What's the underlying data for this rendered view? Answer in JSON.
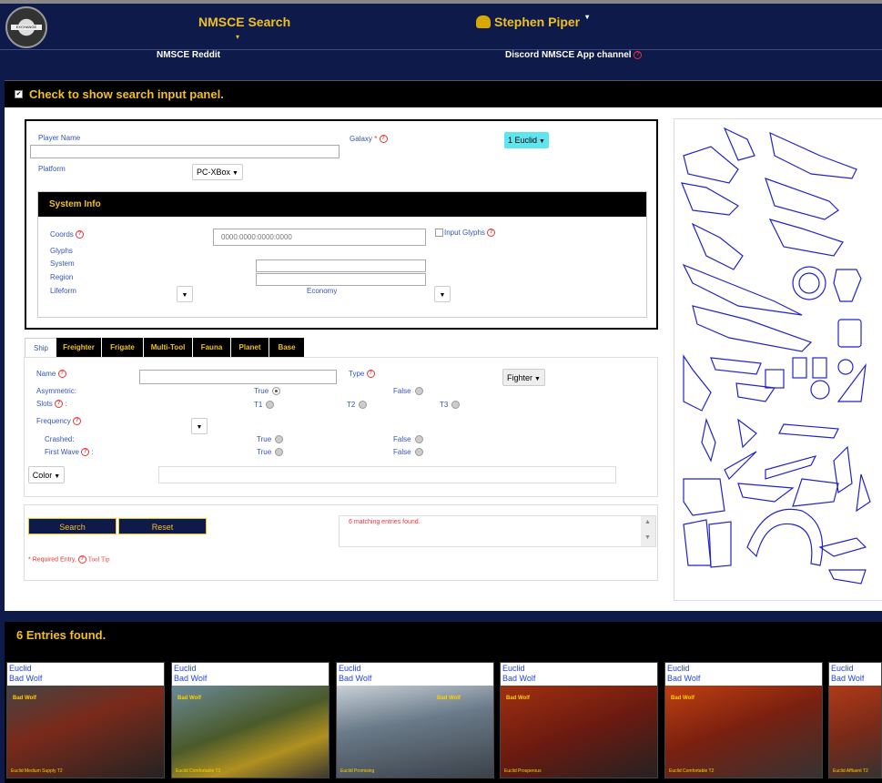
{
  "navbar": {
    "logo_text": "EXCHANGE",
    "search_label": "NMSCE Search",
    "search_caret": "▾",
    "user_label": "Stephen Piper",
    "user_caret": "▾"
  },
  "sublinks": {
    "reddit": "NMSCE Reddit",
    "discord": "Discord NMSCE App channel"
  },
  "panel_toggle": {
    "checkbox": "✔",
    "label": "Check to show search input panel."
  },
  "player": {
    "player_name_label": "Player Name",
    "galaxy_label": "Galaxy",
    "galaxy_required": "*",
    "galaxy_value": "1 Euclid",
    "platform_label": "Platform",
    "platform_value": "PC-XBox"
  },
  "system_info": {
    "title": "System Info",
    "coords_label": "Coords",
    "coords_placeholder": "0000:0000:0000:0000",
    "input_glyphs_label": "Input Glyphs",
    "glyphs_label": "Glyphs",
    "system_label": "System",
    "region_label": "Region",
    "lifeform_label": "Lifeform",
    "economy_label": "Economy"
  },
  "tabs": [
    "Ship",
    "Freighter",
    "Frigate",
    "Multi-Tool",
    "Fauna",
    "Planet",
    "Base"
  ],
  "ship": {
    "name_label": "Name",
    "type_label": "Type",
    "type_value": "Fighter",
    "asymmetric_label": "Asymmetric:",
    "true_label": "True",
    "false_label": "False",
    "slots_label": "Slots",
    "slots_colon": ":",
    "t1": "T1",
    "t2": "T2",
    "t3": "T3",
    "frequency_label": "Frequency",
    "crashed_label": "Crashed:",
    "first_wave_label": "First Wave",
    "first_wave_colon": ":",
    "color_label": "Color"
  },
  "actions": {
    "search": "Search",
    "reset": "Reset",
    "required_entry": "* Required Entry,",
    "tool_tip": "Tool Tip",
    "message": "6 matching entries found."
  },
  "entries": {
    "heading": "6 Entries found.",
    "cards": [
      {
        "galaxy": "Euclid",
        "player": "Bad Wolf",
        "ship_name": "Bad Wolf",
        "caption": "Euclid Medium Supply T2",
        "bg": "#7a2a1a"
      },
      {
        "galaxy": "Euclid",
        "player": "Bad Wolf",
        "ship_name": "Bad Wolf",
        "caption": "Euclid  Comfortable  T2",
        "bg": "#4a5a2a"
      },
      {
        "galaxy": "Euclid",
        "player": "Bad Wolf",
        "ship_name": "Bad Wolf",
        "caption": "Euclid  Promising",
        "bg": "#6a7a88"
      },
      {
        "galaxy": "Euclid",
        "player": "Bad Wolf",
        "ship_name": "Bad Wolf",
        "caption": "Euclid  Prosperous",
        "bg": "#6a1a10"
      },
      {
        "galaxy": "Euclid",
        "player": "Bad Wolf",
        "ship_name": "Bad Wolf",
        "caption": "Euclid  Comfortable T2",
        "bg": "#7a2010"
      },
      {
        "galaxy": "Euclid",
        "player": "Bad Wolf",
        "ship_name": "Bad Wolf",
        "caption": "Euclid  Affluent  T2",
        "bg": "#7a2a18"
      }
    ]
  },
  "colors": {
    "navy": "#0d1a4a",
    "gold": "#f0c020",
    "label_blue": "#3355bb",
    "cyan": "#5ee5ef"
  }
}
